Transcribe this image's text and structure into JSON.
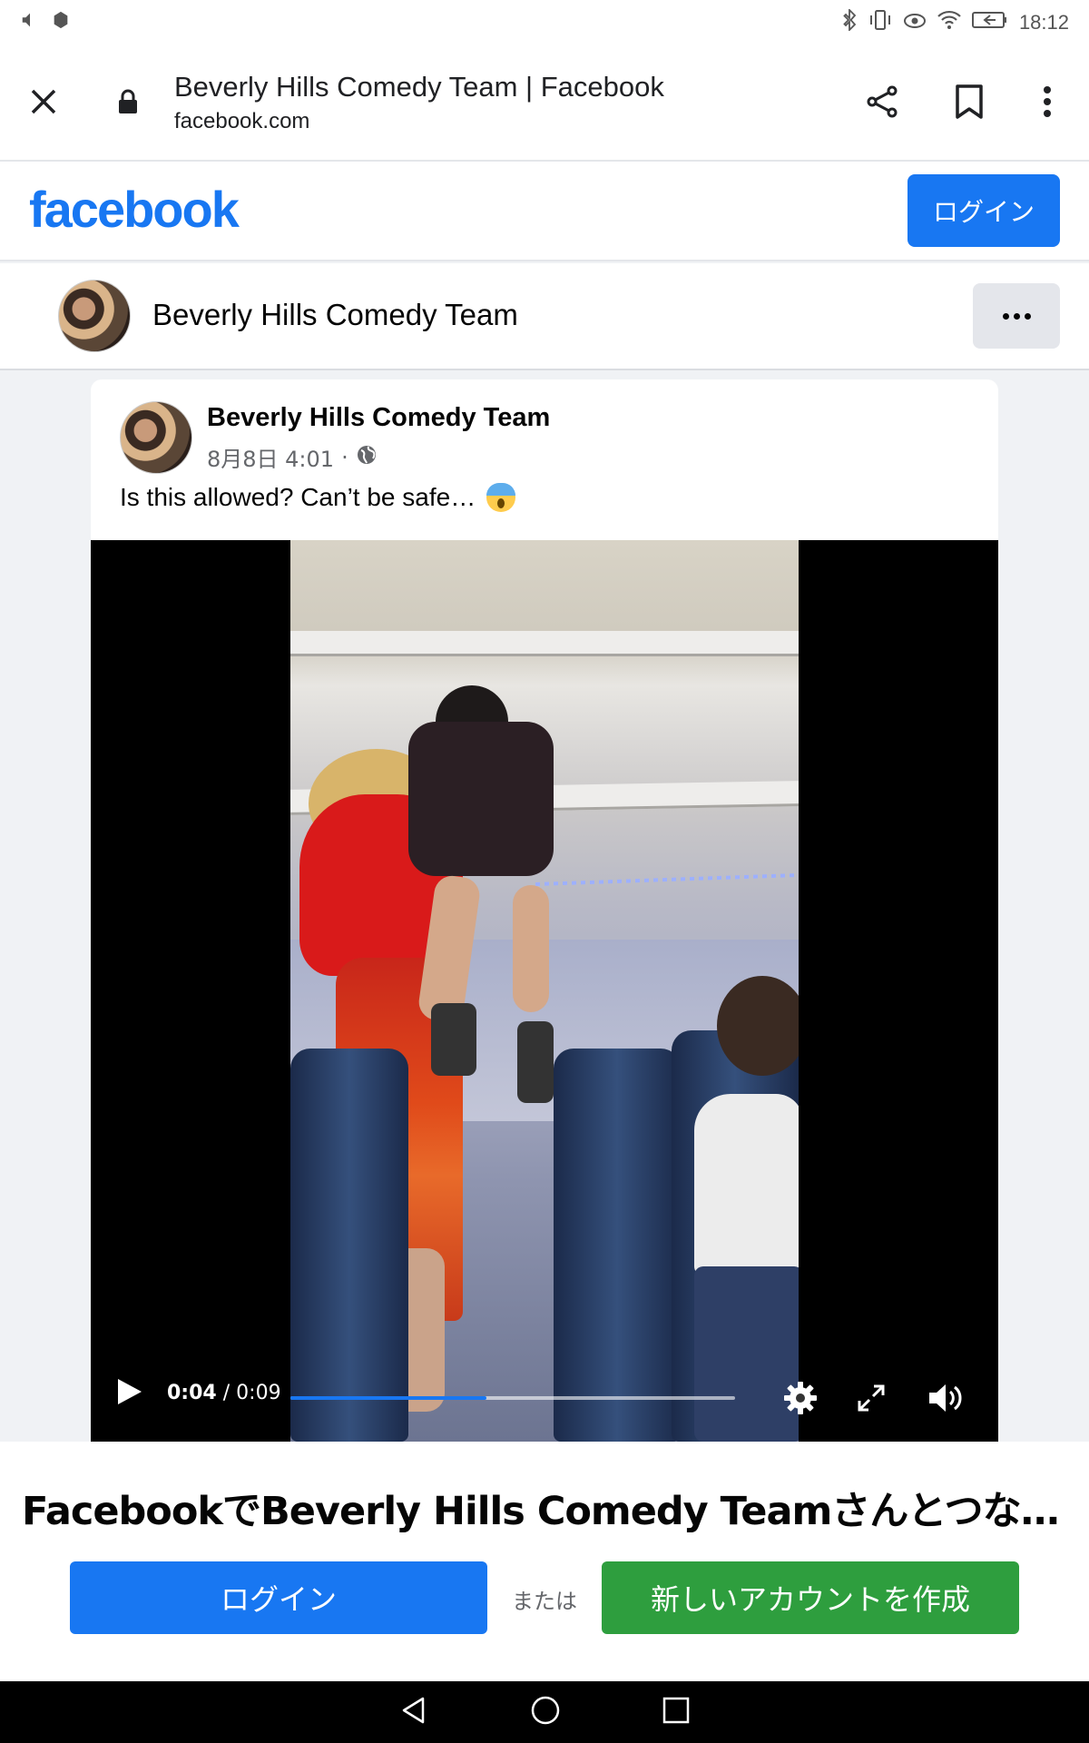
{
  "status_bar": {
    "time": "18:12"
  },
  "browser": {
    "title": "Beverly Hills Comedy Team | Facebook",
    "domain": "facebook.com",
    "icons": [
      "close-icon",
      "lock-icon",
      "share-icon",
      "bookmark-icon",
      "more-vert-icon"
    ]
  },
  "fb_header": {
    "logo": "facebook",
    "login_label": "ログイン"
  },
  "page_bar": {
    "page_name": "Beverly Hills Comedy Team"
  },
  "post": {
    "author": "Beverly Hills Comedy Team",
    "date": "8月8日 4:01",
    "separator": "·",
    "text": "Is this allowed? Can’t be safe…",
    "emoji": "screaming-face-emoji"
  },
  "video": {
    "current_time": "0:04",
    "time_separator": "/",
    "duration": "0:09",
    "progress": 0.44
  },
  "bottom_sheet": {
    "title": "FacebookでBeverly Hills Comedy Teamさんとつながろう",
    "login_label": "ログイン",
    "or_label": "または",
    "create_label": "新しいアカウントを作成"
  },
  "colors": {
    "brand": "#1877f2",
    "create": "#2e9e3e"
  }
}
